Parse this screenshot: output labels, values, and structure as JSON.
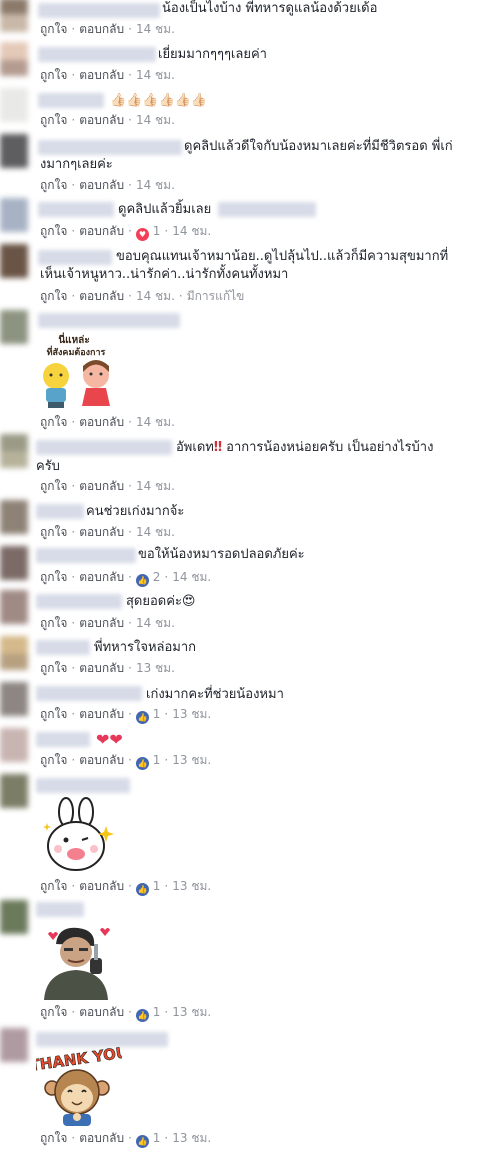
{
  "ui": {
    "like": "ถูกใจ",
    "reply": "ตอบกลับ",
    "edited": "มีการแก้ไข"
  },
  "comments": [
    {
      "text": "น้องเป็นไงบ้าง พี่ทหารดูแลน้องด้วยเด้อ",
      "time": "14 ชม."
    },
    {
      "text": "เยี่ยมมากๆๆๆเลยค่า",
      "time": "14 ชม."
    },
    {
      "text": "",
      "time": "14 ชม.",
      "emoji": "👍🏻👍🏻👍🏻👍🏻👍🏻👍🏻"
    },
    {
      "text1": "ดูคลิปแล้วดีใจกับน้องหมาเลยค่ะที่มีชีวิตรอด พี่เก่",
      "text2": "งมากๆเลยค่ะ",
      "time": "14 ชม."
    },
    {
      "text": "ดูคลิปแล้วยิ้มเลย",
      "time": "14 ชม.",
      "reaction_count": "1"
    },
    {
      "text1": "ขอบคุณแทนเจ้าหมาน้อย..ดูไปลุ้นไป..แล้วก็มีความสุขมากที่",
      "text2": "เห็นเจ้าหนูหาว..น่ารักค่า..น่ารักทั้งคนทั้งหมา",
      "time": "14 ชม."
    },
    {
      "sticker_text1": "นี่แหล่ะ",
      "sticker_text2": "ที่สังคมต้องการ",
      "time": "14 ชม."
    },
    {
      "text1a": "อัพเดท",
      "text1b": "‼",
      "text1c": " อาการน้องหน่อยครับ เป็นอย่างไรบ้าง",
      "text2": "ครับ",
      "time": "14 ชม."
    },
    {
      "text": "คนช่วยเก่งมากจ้ะ",
      "time": "14 ชม."
    },
    {
      "text": "ขอให้น้องหมารอดปลอดภัยค่ะ",
      "time": "14 ชม.",
      "reaction_count": "2"
    },
    {
      "text": "สุดยอดค่ะ😍",
      "time": "14 ชม."
    },
    {
      "text": "พี่ทหารใจหล่อมาก",
      "time": "13 ชม."
    },
    {
      "text": "เก่งมากคะที่ช่วยน้องหมา",
      "time": "13 ชม.",
      "reaction_count": "1"
    },
    {
      "text": "",
      "time": "13 ชม.",
      "emoji": "❤❤",
      "reaction_count": "1"
    },
    {
      "time": "13 ชม.",
      "reaction_count": "1"
    },
    {
      "time": "13 ชม.",
      "reaction_count": "1"
    },
    {
      "sticker_text": "THANK YOU",
      "time": "13 ชม.",
      "reaction_count": "1"
    }
  ],
  "colors": {
    "meta": "#90949c",
    "link": "#4b4f56",
    "like": "#4267b2",
    "heart": "#f33e58",
    "name_blur": "#d7dbe7"
  }
}
